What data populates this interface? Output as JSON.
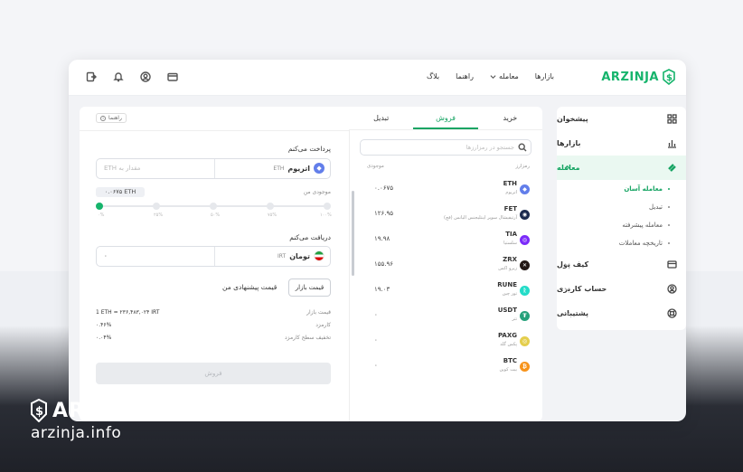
{
  "brand": {
    "name": "ARZINJA",
    "color": "#16b46c"
  },
  "navbar": {
    "links": [
      "بازارها",
      "معامله",
      "راهنما",
      "بلاگ"
    ],
    "icons": [
      "wallet-icon",
      "user-icon",
      "bell-icon",
      "exit-icon"
    ]
  },
  "sidebar": {
    "items": [
      {
        "label": "پیشخوان",
        "icon": "dashboard-icon"
      },
      {
        "label": "بازارها",
        "icon": "chart-icon"
      },
      {
        "label": "معامله",
        "icon": "trade-icon",
        "active": true
      },
      {
        "label": "کیف پول",
        "icon": "wallet-icon"
      },
      {
        "label": "حساب کاربری",
        "icon": "user-icon"
      },
      {
        "label": "پشتیبانی",
        "icon": "support-icon"
      }
    ],
    "subitems": [
      "معامله آسان",
      "تبدیل",
      "معامله پیشرفته",
      "تاریخچه معاملات"
    ]
  },
  "tabs": [
    "خرید",
    "فروش",
    "تبدیل"
  ],
  "active_tab": "فروش",
  "guide_label": "راهنما",
  "pay": {
    "label": "پرداخت می‌کنم",
    "placeholder": "مقدار به ETH",
    "coin_name": "اتریوم",
    "coin_symbol": "ETH",
    "balance_label": "موجودی من",
    "balance_value": "۰.۰۶۷۵ ETH",
    "slider_marks": [
      "۰%",
      "۲۵%",
      "۵۰%",
      "۷۵%",
      "۱۰۰%"
    ],
    "slider_value_percent": 0
  },
  "receive": {
    "label": "دریافت می‌کنم",
    "value": "۰",
    "coin_name": "تومان",
    "coin_symbol": "IRT"
  },
  "market_price_button": "قیمت بازار",
  "my_offer_label": "قیمت پیشنهادی من",
  "info": [
    {
      "key": "قیمت بازار",
      "value": "1 ETH = ۲۳۶,۴۸۳,۰۲۴ IRT"
    },
    {
      "key": "کارمزد",
      "value": "۰.۴۶%"
    },
    {
      "key": "تخفیف سطح کارمزد",
      "value": "۰.۰۴%"
    }
  ],
  "sell_button": "فروش",
  "search": {
    "placeholder": "جستجو در رمزارزها"
  },
  "list_headers": {
    "coin": "رمزارز",
    "balance": "موجودی"
  },
  "coins": [
    {
      "symbol": "ETH",
      "name": "اتریوم",
      "balance": "۰.۰۶۷۵",
      "color": "#627eea",
      "glyph": "◆"
    },
    {
      "symbol": "FET",
      "name": "آرتیفیشال سوپر اینتلیجنس الیانس (فچ)",
      "balance": "۱۲۶.۹۵",
      "color": "#1d2b4f",
      "glyph": "◉"
    },
    {
      "symbol": "TIA",
      "name": "سلستیا",
      "balance": "۱۹.۹۸",
      "color": "#7b2bf9",
      "glyph": "◎"
    },
    {
      "symbol": "ZRX",
      "name": "زیرو اکس",
      "balance": "۱۵۵.۹۶",
      "color": "#231815",
      "glyph": "✕"
    },
    {
      "symbol": "RUNE",
      "name": "تور چین",
      "balance": "۱۹.۰۳",
      "color": "#23dcc8",
      "glyph": "ᚱ"
    },
    {
      "symbol": "USDT",
      "name": "تتر",
      "balance": "۰",
      "color": "#26a17b",
      "glyph": "₮"
    },
    {
      "symbol": "PAXG",
      "name": "پکس گلد",
      "balance": "۰",
      "color": "#e4ce4d",
      "glyph": "◎"
    },
    {
      "symbol": "BTC",
      "name": "بیت کوین",
      "balance": "۰",
      "color": "#f7931a",
      "glyph": "₿"
    }
  ],
  "watermark": {
    "brand": "ARZINJA",
    "site": "arzinja.info"
  }
}
